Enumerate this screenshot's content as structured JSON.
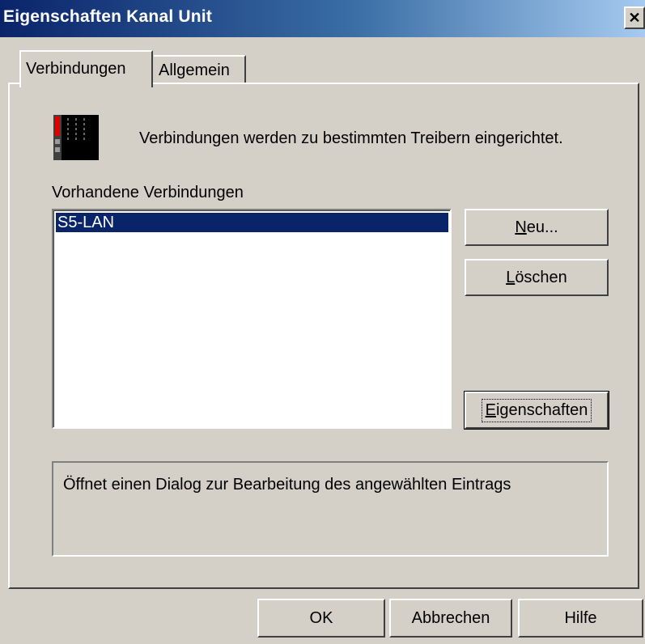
{
  "window": {
    "title": "Eigenschaften Kanal Unit",
    "close_glyph": "✕"
  },
  "tabs": [
    {
      "label": "Verbindungen",
      "active": true
    },
    {
      "label": "Allgemein",
      "active": false
    }
  ],
  "connections_page": {
    "icon": "device-rack-icon",
    "intro": "Verbindungen werden zu bestimmten Treibern eingerichtet.",
    "list_label": "Vorhandene Verbindungen",
    "connections": [
      "S5-LAN"
    ],
    "selected_index": 0,
    "buttons": {
      "new": {
        "mnemonic": "N",
        "rest": "eu..."
      },
      "delete": {
        "mnemonic": "L",
        "rest": "öschen"
      },
      "properties": {
        "mnemonic": "E",
        "rest": "igenschaften"
      }
    },
    "description": "Öffnet einen Dialog zur Bearbeitung des angewählten Eintrags"
  },
  "footer": {
    "ok": "OK",
    "cancel": "Abbrechen",
    "help": "Hilfe"
  },
  "colors": {
    "titlebar_start": "#0a246a",
    "titlebar_end": "#a6caf0",
    "selection": "#0a246a",
    "face": "#d4d0c8",
    "icon_red": "#e00000"
  }
}
